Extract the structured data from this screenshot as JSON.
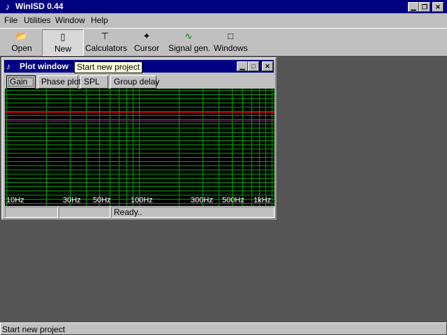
{
  "app": {
    "title": "WinISD 0.44",
    "icon": "speaker-icon",
    "window_buttons": [
      "minimize",
      "restore",
      "close"
    ]
  },
  "menu": [
    "File",
    "Utilities",
    "Window",
    "Help"
  ],
  "toolbar": [
    {
      "label": "Open",
      "icon": "folder-open-icon"
    },
    {
      "label": "New",
      "icon": "new-project-icon",
      "pressed": true
    },
    {
      "label": "Calculators",
      "icon": "calculator-icon"
    },
    {
      "label": "Cursor",
      "icon": "crosshair-icon"
    },
    {
      "label": "Signal gen.",
      "icon": "signal-generator-icon"
    },
    {
      "label": "Windows",
      "icon": "windows-icon"
    }
  ],
  "plot_window": {
    "title": "Plot window",
    "tabs": [
      {
        "label": "Gain",
        "active": true
      },
      {
        "label": "Phase plot"
      },
      {
        "label": "SPL"
      },
      {
        "label": "Group delay"
      }
    ],
    "x_tick_labels": [
      "10Hz",
      "30Hz",
      "50Hz",
      "100Hz",
      "300Hz",
      "500Hz",
      "1kHz"
    ],
    "status": {
      "panel1": "",
      "panel2": "",
      "panel3": "Ready.."
    },
    "colors": {
      "background": "#000000",
      "grid": "#00a000",
      "trace_red": "#ff0000",
      "trace_purple": "#b000b0"
    }
  },
  "tooltip": "Start new project",
  "statusbar": "Start new project"
}
